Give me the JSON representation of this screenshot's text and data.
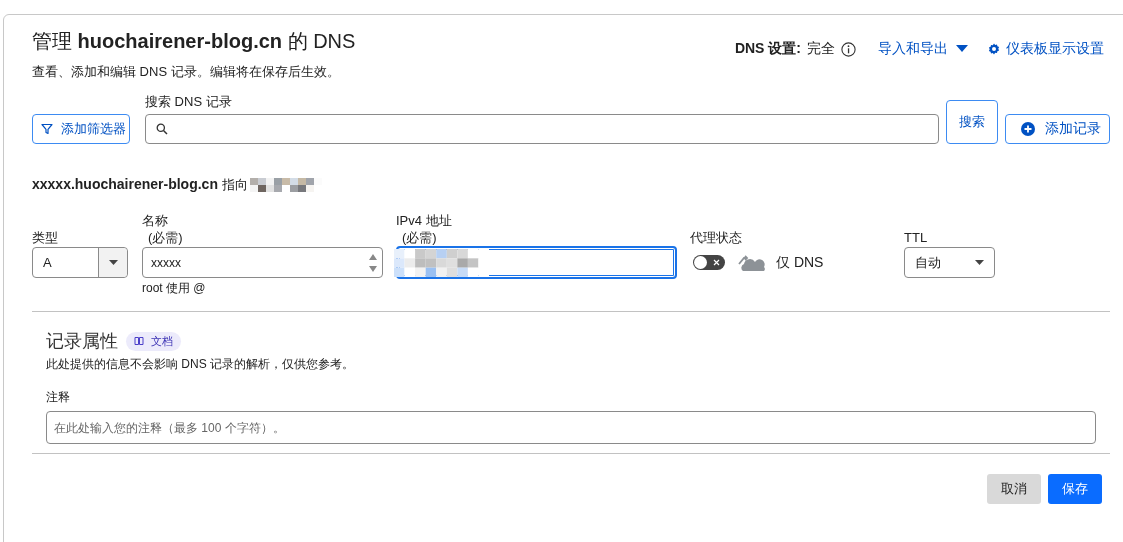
{
  "header": {
    "title": "管理 **huochairener-blog.cn** 的 DNS",
    "subtitle": "查看、添加和编辑 DNS 记录。编辑将在保存后生效。",
    "dns_setting": {
      "label": "DNS 设置:",
      "value": "完全"
    },
    "links": [
      {
        "label": "导入和导出",
        "kind": "dropdown"
      },
      {
        "label": "仪表板显示设置",
        "kind": "settings"
      }
    ]
  },
  "toolbar": {
    "filter_button": "添加筛选器",
    "search_label": "搜索 DNS 记录",
    "search_button": "搜索",
    "add_button": "添加记录"
  },
  "record": {
    "summary": "**xxxxx.huochairener-blog.cn** 指向",
    "type": {
      "label": "类型",
      "value": "A"
    },
    "name": {
      "label": "名称",
      "required": "(必需)",
      "value": "xxxxx",
      "hint": "root 使用 @"
    },
    "ipv4": {
      "label": "IPv4 地址",
      "required": "(必需)",
      "focused": true
    },
    "proxy": {
      "label": "代理状态",
      "on": false,
      "status": "仅 DNS"
    },
    "ttl": {
      "label": "TTL",
      "value": "自动"
    }
  },
  "attributes": {
    "title": "记录属性",
    "badge": "文档",
    "description": "此处提供的信息不会影响 DNS 记录的解析，仅供您参考。",
    "comment_label": "注释",
    "comment_placeholder": "在此处输入您的注释（最多 100 个字符）。"
  },
  "footer": {
    "buttons": [
      {
        "label": "取消",
        "kind": "secondary"
      },
      {
        "label": "保存",
        "kind": "primary"
      }
    ]
  }
}
